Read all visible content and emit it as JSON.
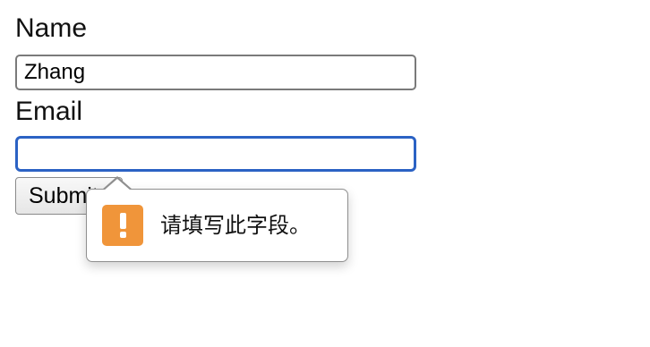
{
  "form": {
    "name_label": "Name",
    "name_value": "Zhang",
    "email_label": "Email",
    "email_value": "",
    "submit_label": "Submit"
  },
  "validation_tooltip": {
    "message": "请填写此字段。",
    "icon": "warning-exclamation-icon",
    "icon_color": "#f0953a"
  },
  "colors": {
    "focus_border": "#2b62c4"
  }
}
